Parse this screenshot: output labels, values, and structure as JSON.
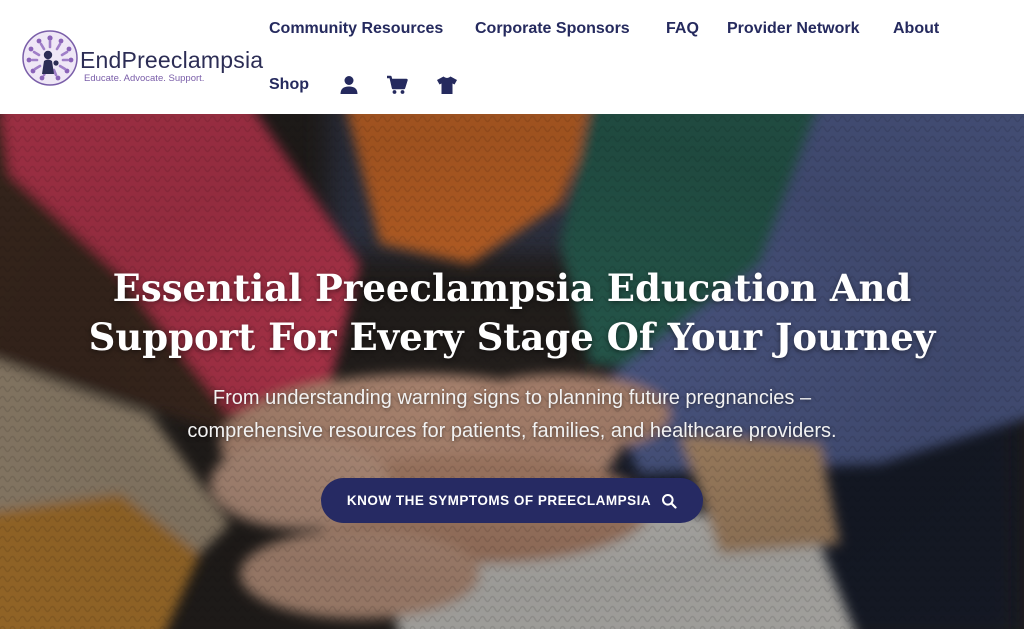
{
  "brand": {
    "name": "EndPreeclampsia",
    "tagline": "Educate. Advocate. Support."
  },
  "nav": {
    "community_resources": "Community Resources",
    "corporate_sponsors": "Corporate Sponsors",
    "faq": "FAQ",
    "provider_network": "Provider Network",
    "about": "About",
    "shop": "Shop"
  },
  "nav_icons": {
    "account": "user-icon",
    "cart": "cart-icon",
    "merch": "tshirt-icon"
  },
  "hero": {
    "title_line1": "Essential Preeclampsia Education And",
    "title_line2": "Support For Every Stage Of Your Journey",
    "subtitle_line1": "From understanding warning signs to planning future pregnancies –",
    "subtitle_line2": "comprehensive resources for patients, families, and healthcare providers.",
    "cta_label": "KNOW THE SYMPTOMS OF PREECLAMPSIA",
    "cta_icon": "search-icon"
  },
  "colors": {
    "nav_text": "#252a5e",
    "button_bg": "#262a63",
    "brand_text": "#2c2d55",
    "tagline": "#7a5ea9"
  }
}
